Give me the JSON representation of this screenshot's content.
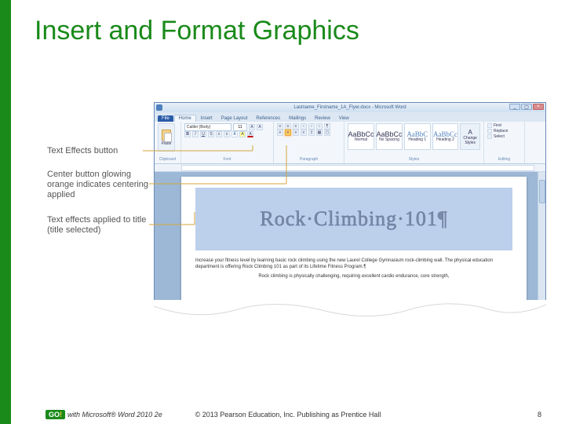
{
  "slide": {
    "title": "Insert and Format Graphics",
    "page_number": "8"
  },
  "footer": {
    "go_label": "GO",
    "go_exclaim": "!",
    "product": "with Microsoft® Word 2010 2e",
    "copyright": "© 2013 Pearson Education, Inc. Publishing as Prentice Hall"
  },
  "callouts": {
    "text_effects": "Text Effects button",
    "center_button": "Center button glowing orange indicates centering applied",
    "text_applied": "Text effects applied to title (title selected)"
  },
  "word": {
    "titlebar": "Lastname_Firstname_1A_Flyer.docx - Microsoft Word",
    "tabs": {
      "file": "File",
      "home": "Home",
      "insert": "Insert",
      "page_layout": "Page Layout",
      "references": "References",
      "mailings": "Mailings",
      "review": "Review",
      "view": "View"
    },
    "ribbon": {
      "clipboard_label": "Clipboard",
      "paste": "Paste",
      "font_label": "Font",
      "font_name": "Calibri (Body)",
      "font_size": "11",
      "paragraph_label": "Paragraph",
      "styles_label": "Styles",
      "editing_label": "Editing",
      "style_normal": "Normal",
      "style_nospacing": "No Spacing",
      "style_heading1": "Heading 1",
      "style_heading2": "Heading 2",
      "change_styles": "Change Styles",
      "find": "Find",
      "replace": "Replace",
      "select": "Select"
    },
    "document": {
      "hero": "Rock·Climbing·101¶",
      "body1": "Increase your fitness level by learning basic rock climbing using the new Laurel College Gymnasium rock-climbing wall. The physical education department is offering Rock Climbing 101 as part of its Lifetime Fitness Program.¶",
      "body2": "Rock climbing is physically challenging, requiring excellent cardio endurance, core strength,"
    }
  }
}
